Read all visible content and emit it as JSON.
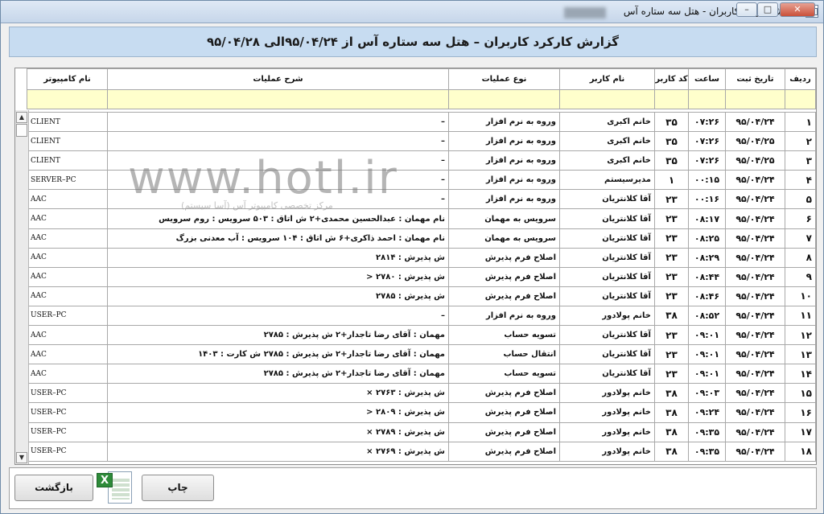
{
  "window": {
    "title": "گزارش کارکرد کاربران - هتل سه ستاره آس"
  },
  "report": {
    "title": "گزارش کارکرد کاربران – هتل سه ستاره آس از ۹۵/۰۴/۲۴الی ۹۵/۰۴/۲۸"
  },
  "watermark": {
    "url": "www.hotl.ir",
    "subtitle": "مرکز تخصصی کامپیوتر آس (آسا سیستم)"
  },
  "table": {
    "columns": {
      "id": "ردیف",
      "date": "تاریخ ثبت",
      "time": "ساعت",
      "code": "کد کاربر",
      "user": "نام کاربر",
      "type": "نوع عملیات",
      "desc": "شرح عملیات",
      "pc": "نام کامپیوتر"
    },
    "rows": [
      {
        "id": "۱",
        "date": "۹۵/۰۴/۲۴",
        "time": "۰۷:۲۶",
        "code": "۳۵",
        "user": "خانم اکبری",
        "type": "وروه به نرم افزار",
        "desc": "–",
        "pc": "CLIENT"
      },
      {
        "id": "۲",
        "date": "۹۵/۰۴/۲۵",
        "time": "۰۷:۲۶",
        "code": "۳۵",
        "user": "خانم اکبری",
        "type": "وروه به نرم افزار",
        "desc": "–",
        "pc": "CLIENT"
      },
      {
        "id": "۳",
        "date": "۹۵/۰۴/۲۵",
        "time": "۰۷:۲۶",
        "code": "۳۵",
        "user": "خانم اکبری",
        "type": "وروه به نرم افزار",
        "desc": "–",
        "pc": "CLIENT"
      },
      {
        "id": "۴",
        "date": "۹۵/۰۴/۲۴",
        "time": "۰۰:۱۵",
        "code": "۱",
        "user": "مدیرسیستم",
        "type": "وروه به نرم افزار",
        "desc": "–",
        "pc": "SERVER–PC"
      },
      {
        "id": "۵",
        "date": "۹۵/۰۴/۲۴",
        "time": "۰۰:۱۶",
        "code": "۲۳",
        "user": "آقا کلانتریان",
        "type": "وروه به نرم افزار",
        "desc": "–",
        "pc": "AAC"
      },
      {
        "id": "۶",
        "date": "۹۵/۰۴/۲۴",
        "time": "۰۸:۱۷",
        "code": "۲۳",
        "user": "آقا کلانتریان",
        "type": "سرویس به مهمان",
        "desc": "نام مهمان : عبدالحسین محمدی+۲ ش اتاق : ۵۰۳ سرویس : روم سرویس",
        "pc": "AAC"
      },
      {
        "id": "۷",
        "date": "۹۵/۰۴/۲۴",
        "time": "۰۸:۲۵",
        "code": "۲۳",
        "user": "آقا کلانتریان",
        "type": "سرویس به مهمان",
        "desc": "نام مهمان : احمد ذاکری+۶ ش اتاق : ۱۰۴ سرویس : آب معدنی بزرگ",
        "pc": "AAC"
      },
      {
        "id": "۸",
        "date": "۹۵/۰۴/۲۴",
        "time": "۰۸:۲۹",
        "code": "۲۳",
        "user": "آقا کلانتریان",
        "type": "اصلاح فرم پذیرش",
        "desc": "ش پذیرش : ۲۸۱۴",
        "pc": "AAC"
      },
      {
        "id": "۹",
        "date": "۹۵/۰۴/۲۴",
        "time": "۰۸:۴۴",
        "code": "۲۳",
        "user": "آقا کلانتریان",
        "type": "اصلاح فرم پذیرش",
        "desc": "ش پذیرش : ۲۷۸۰ <",
        "pc": "AAC"
      },
      {
        "id": "۱۰",
        "date": "۹۵/۰۴/۲۴",
        "time": "۰۸:۴۶",
        "code": "۲۳",
        "user": "آقا کلانتریان",
        "type": "اصلاح فرم پذیرش",
        "desc": "ش پذیرش : ۲۷۸۵",
        "pc": "AAC"
      },
      {
        "id": "۱۱",
        "date": "۹۵/۰۴/۲۴",
        "time": "۰۸:۵۲",
        "code": "۳۸",
        "user": "خانم پولادور",
        "type": "وروه به نرم افزار",
        "desc": "–",
        "pc": "USER–PC"
      },
      {
        "id": "۱۲",
        "date": "۹۵/۰۴/۲۴",
        "time": "۰۹:۰۱",
        "code": "۲۳",
        "user": "آقا کلانتریان",
        "type": "تسویه حساب",
        "desc": "مهمان : آقای رضا تاجدار+۲ ش پذیرش : ۲۷۸۵",
        "pc": "AAC"
      },
      {
        "id": "۱۳",
        "date": "۹۵/۰۴/۲۴",
        "time": "۰۹:۰۱",
        "code": "۲۳",
        "user": "آقا کلانتریان",
        "type": "انتقال حساب",
        "desc": "مهمان : آقای رضا تاجدار+۲ ش پذیرش : ۲۷۸۵ ش کارت : ۱۴۰۳",
        "pc": "AAC"
      },
      {
        "id": "۱۴",
        "date": "۹۵/۰۴/۲۴",
        "time": "۰۹:۰۱",
        "code": "۲۳",
        "user": "آقا کلانتریان",
        "type": "تسویه حساب",
        "desc": "مهمان : آقای رضا تاجدار+۲ ش پذیرش : ۲۷۸۵",
        "pc": "AAC"
      },
      {
        "id": "۱۵",
        "date": "۹۵/۰۴/۲۴",
        "time": "۰۹:۰۳",
        "code": "۳۸",
        "user": "خانم پولادور",
        "type": "اصلاح فرم پذیرش",
        "desc": "ش پذیرش : ۲۷۶۳ ×",
        "pc": "USER–PC"
      },
      {
        "id": "۱۶",
        "date": "۹۵/۰۴/۲۴",
        "time": "۰۹:۲۴",
        "code": "۳۸",
        "user": "خانم پولادور",
        "type": "اصلاح فرم پذیرش",
        "desc": "ش پذیرش : ۲۸۰۹ <",
        "pc": "USER–PC"
      },
      {
        "id": "۱۷",
        "date": "۹۵/۰۴/۲۴",
        "time": "۰۹:۳۵",
        "code": "۳۸",
        "user": "خانم پولادور",
        "type": "اصلاح فرم پذیرش",
        "desc": "ش پذیرش : ۲۷۸۹ ×",
        "pc": "USER–PC"
      },
      {
        "id": "۱۸",
        "date": "۹۵/۰۴/۲۴",
        "time": "۰۹:۳۵",
        "code": "۳۸",
        "user": "خانم پولادور",
        "type": "اصلاح فرم پذیرش",
        "desc": "ش پذیرش : ۲۷۶۹ ×",
        "pc": "USER–PC"
      }
    ]
  },
  "buttons": {
    "back": "بازگشت",
    "print": "چاپ",
    "excel_icon": "excel-export-icon"
  },
  "colors": {
    "header_bg": "#c7dcf1",
    "filter_row_bg": "#ffffcc"
  }
}
